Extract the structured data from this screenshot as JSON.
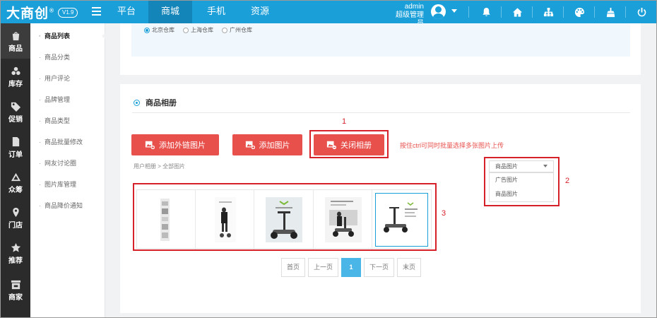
{
  "header": {
    "logo": "大商创",
    "version": "V1.9",
    "nav": [
      "平台",
      "商城",
      "手机",
      "资源"
    ],
    "active_nav": "商城",
    "user": {
      "name": "admin",
      "role": "超级管理员"
    }
  },
  "sidebar": {
    "items": [
      {
        "label": "商品",
        "icon": "bag-icon"
      },
      {
        "label": "库存",
        "icon": "stack-icon"
      },
      {
        "label": "促销",
        "icon": "tag-icon"
      },
      {
        "label": "订单",
        "icon": "document-icon"
      },
      {
        "label": "众筹",
        "icon": "crowd-icon"
      },
      {
        "label": "门店",
        "icon": "location-icon"
      },
      {
        "label": "推荐",
        "icon": "star-icon"
      },
      {
        "label": "商家",
        "icon": "store-icon"
      }
    ]
  },
  "submenu": {
    "items": [
      "商品列表",
      "商品分类",
      "用户评论",
      "品牌管理",
      "商品类型",
      "商品批量修改",
      "网友讨论圈",
      "图片库管理",
      "商品降价通知"
    ]
  },
  "warehouse": {
    "options": [
      "北京仓库",
      "上海仓库",
      "广州仓库"
    ],
    "selected": "北京仓库"
  },
  "album": {
    "title": "商品相册",
    "buttons": {
      "add_external": "添加外链图片",
      "add_image": "添加图片",
      "close_album": "关闭相册"
    },
    "hint": "按住ctrl可同时批量选择多张图片上传",
    "breadcrumb": "用户相册 > 全部图片",
    "select": {
      "current": "商品图片",
      "options": [
        "广告图片",
        "商品图片"
      ]
    },
    "annotations": [
      "1",
      "2",
      "3"
    ]
  },
  "pagination": {
    "first": "首页",
    "prev": "上一页",
    "current": "1",
    "next": "下一页",
    "last": "末页"
  },
  "colors": {
    "primary": "#1a9fd9",
    "danger": "#e8504c",
    "annotation": "#d6202a"
  }
}
